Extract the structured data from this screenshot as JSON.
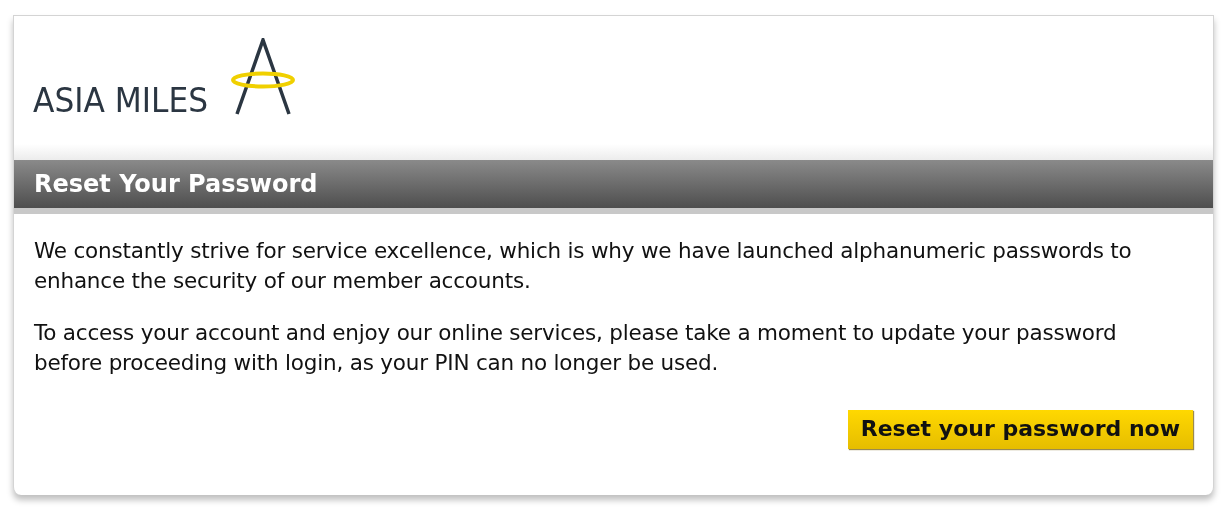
{
  "logo": {
    "text": "ASIA MILES"
  },
  "header": {
    "title": "Reset Your Password"
  },
  "paragraphs": [
    "We constantly strive for service excellence, which is why we have launched alphanumeric passwords to enhance the security of our member accounts.",
    "To access your account and enjoy our online services, please take a moment to update your password before proceeding with login, as your PIN can no longer be used."
  ],
  "button": {
    "label": "Reset your password now"
  }
}
